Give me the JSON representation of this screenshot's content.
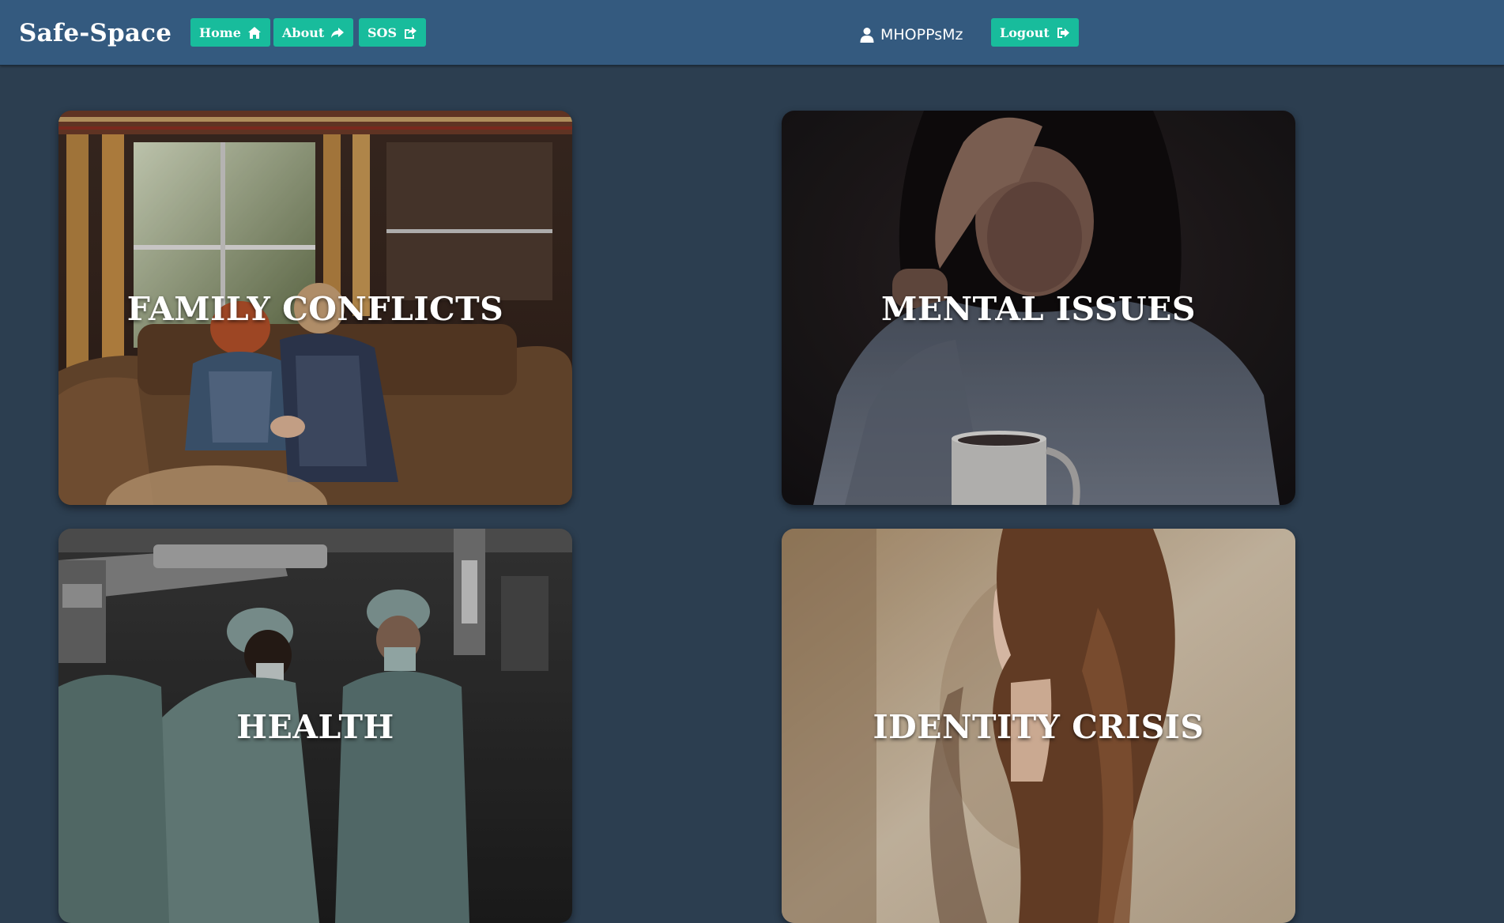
{
  "navbar": {
    "brand": "Safe-Space",
    "home_label": "Home",
    "about_label": "About",
    "sos_label": "SOS",
    "username": "MHOPPsMz",
    "logout_label": "Logout",
    "accent_color": "#18bc9c",
    "bar_color": "#345a7f"
  },
  "page": {
    "background_color": "#2c3e50"
  },
  "cards": [
    {
      "title": "FAMILY CONFLICTS",
      "image": "photo of two people sitting on a couch in distress"
    },
    {
      "title": "MENTAL ISSUES",
      "image": "photo of a woman with hand on forehead and a mug"
    },
    {
      "title": "HEALTH",
      "image": "photo of surgeons in an operating room"
    },
    {
      "title": "IDENTITY CRISIS",
      "image": "double-exposure portrait of a woman"
    }
  ]
}
